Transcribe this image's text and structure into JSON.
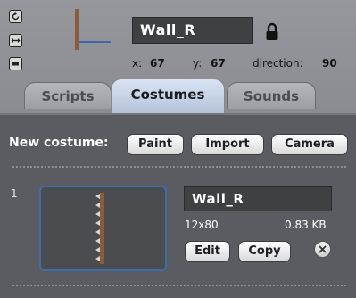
{
  "sprite": {
    "name": "Wall_R",
    "x_label": "x:",
    "x_value": "67",
    "y_label": "y:",
    "y_value": "67",
    "direction_label": "direction:",
    "direction_value": "90",
    "rotation_styles": [
      "rotate-icon",
      "flip-horizontal-icon",
      "no-rotate-icon"
    ]
  },
  "tabs": [
    {
      "label": "Scripts",
      "active": false
    },
    {
      "label": "Costumes",
      "active": true
    },
    {
      "label": "Sounds",
      "active": false
    }
  ],
  "costumes_panel": {
    "new_costume_label": "New costume:",
    "paint_label": "Paint",
    "import_label": "Import",
    "camera_label": "Camera",
    "items": [
      {
        "number": "1",
        "name": "Wall_R",
        "size": "12x80",
        "file_size": "0.83 KB",
        "edit_label": "Edit",
        "copy_label": "Copy"
      }
    ]
  },
  "colors": {
    "header_bg": "#8f9095",
    "panel_bg": "#5b5c61",
    "active_tab": "#c8d5e8",
    "thumb_border": "#3c6ea8",
    "direction_line": "#2457b5"
  }
}
